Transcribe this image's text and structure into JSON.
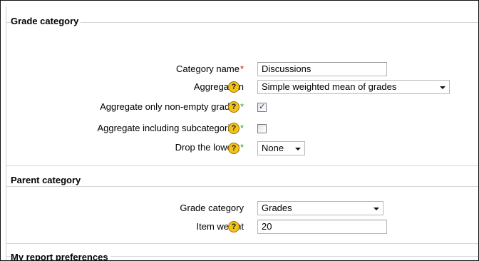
{
  "grade_category_section": {
    "legend": "Grade category",
    "category_name": {
      "label": "Category name",
      "required_marker": "*",
      "value": "Discussions"
    },
    "aggregation": {
      "label": "Aggregation",
      "selected": "Simple weighted mean of grades"
    },
    "aggregate_only_nonempty": {
      "label": "Aggregate only non-empty grades",
      "advanced_marker": "*",
      "checked": true,
      "check_glyph": "✓"
    },
    "aggregate_including_subcategories": {
      "label": "Aggregate including subcategories",
      "advanced_marker": "*",
      "checked": false
    },
    "drop_lowest": {
      "label": "Drop the lowest",
      "advanced_marker": "*",
      "selected": "None"
    }
  },
  "parent_category_section": {
    "legend": "Parent category",
    "grade_category": {
      "label": "Grade category",
      "selected": "Grades"
    },
    "item_weight": {
      "label": "Item weight",
      "value": "20"
    }
  },
  "my_report_preferences_section": {
    "legend": "My report preferences"
  },
  "help_icon_glyph": "?",
  "colors": {
    "required": "#e00000",
    "advanced": "#27a827",
    "help_icon": "#f2c31b"
  }
}
